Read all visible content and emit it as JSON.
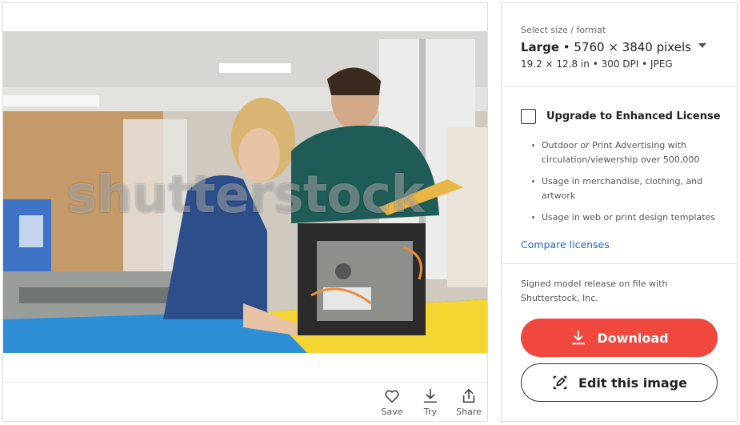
{
  "image": {
    "watermark_text": "shutterstock",
    "alt": "Two engineers examining an electronic device in a lab"
  },
  "image_actions": [
    {
      "id": "save",
      "label": "Save",
      "icon": "heart-icon"
    },
    {
      "id": "try",
      "label": "Try",
      "icon": "download-arrow-icon"
    },
    {
      "id": "share",
      "label": "Share",
      "icon": "share-icon"
    }
  ],
  "size_selector": {
    "caption": "Select size / format",
    "size_name": "Large",
    "size_pixels": "• 5760 × 3840 pixels",
    "details": "19.2 × 12.8 in • 300 DPI • JPEG"
  },
  "license": {
    "upgrade_label": "Upgrade to Enhanced License",
    "checked": false,
    "benefits": [
      "Outdoor or Print Advertising with circulation/viewership over 500,000",
      "Usage in merchandise, clothing, and artwork",
      "Usage in web or print design templates"
    ],
    "compare_link": "Compare licenses"
  },
  "release_note": "Signed model release on file with Shutterstock, Inc.",
  "buttons": {
    "download_label": "Download",
    "edit_label": "Edit this image"
  },
  "colors": {
    "accent_red": "#f0483e",
    "link_blue": "#1a6ad6"
  }
}
